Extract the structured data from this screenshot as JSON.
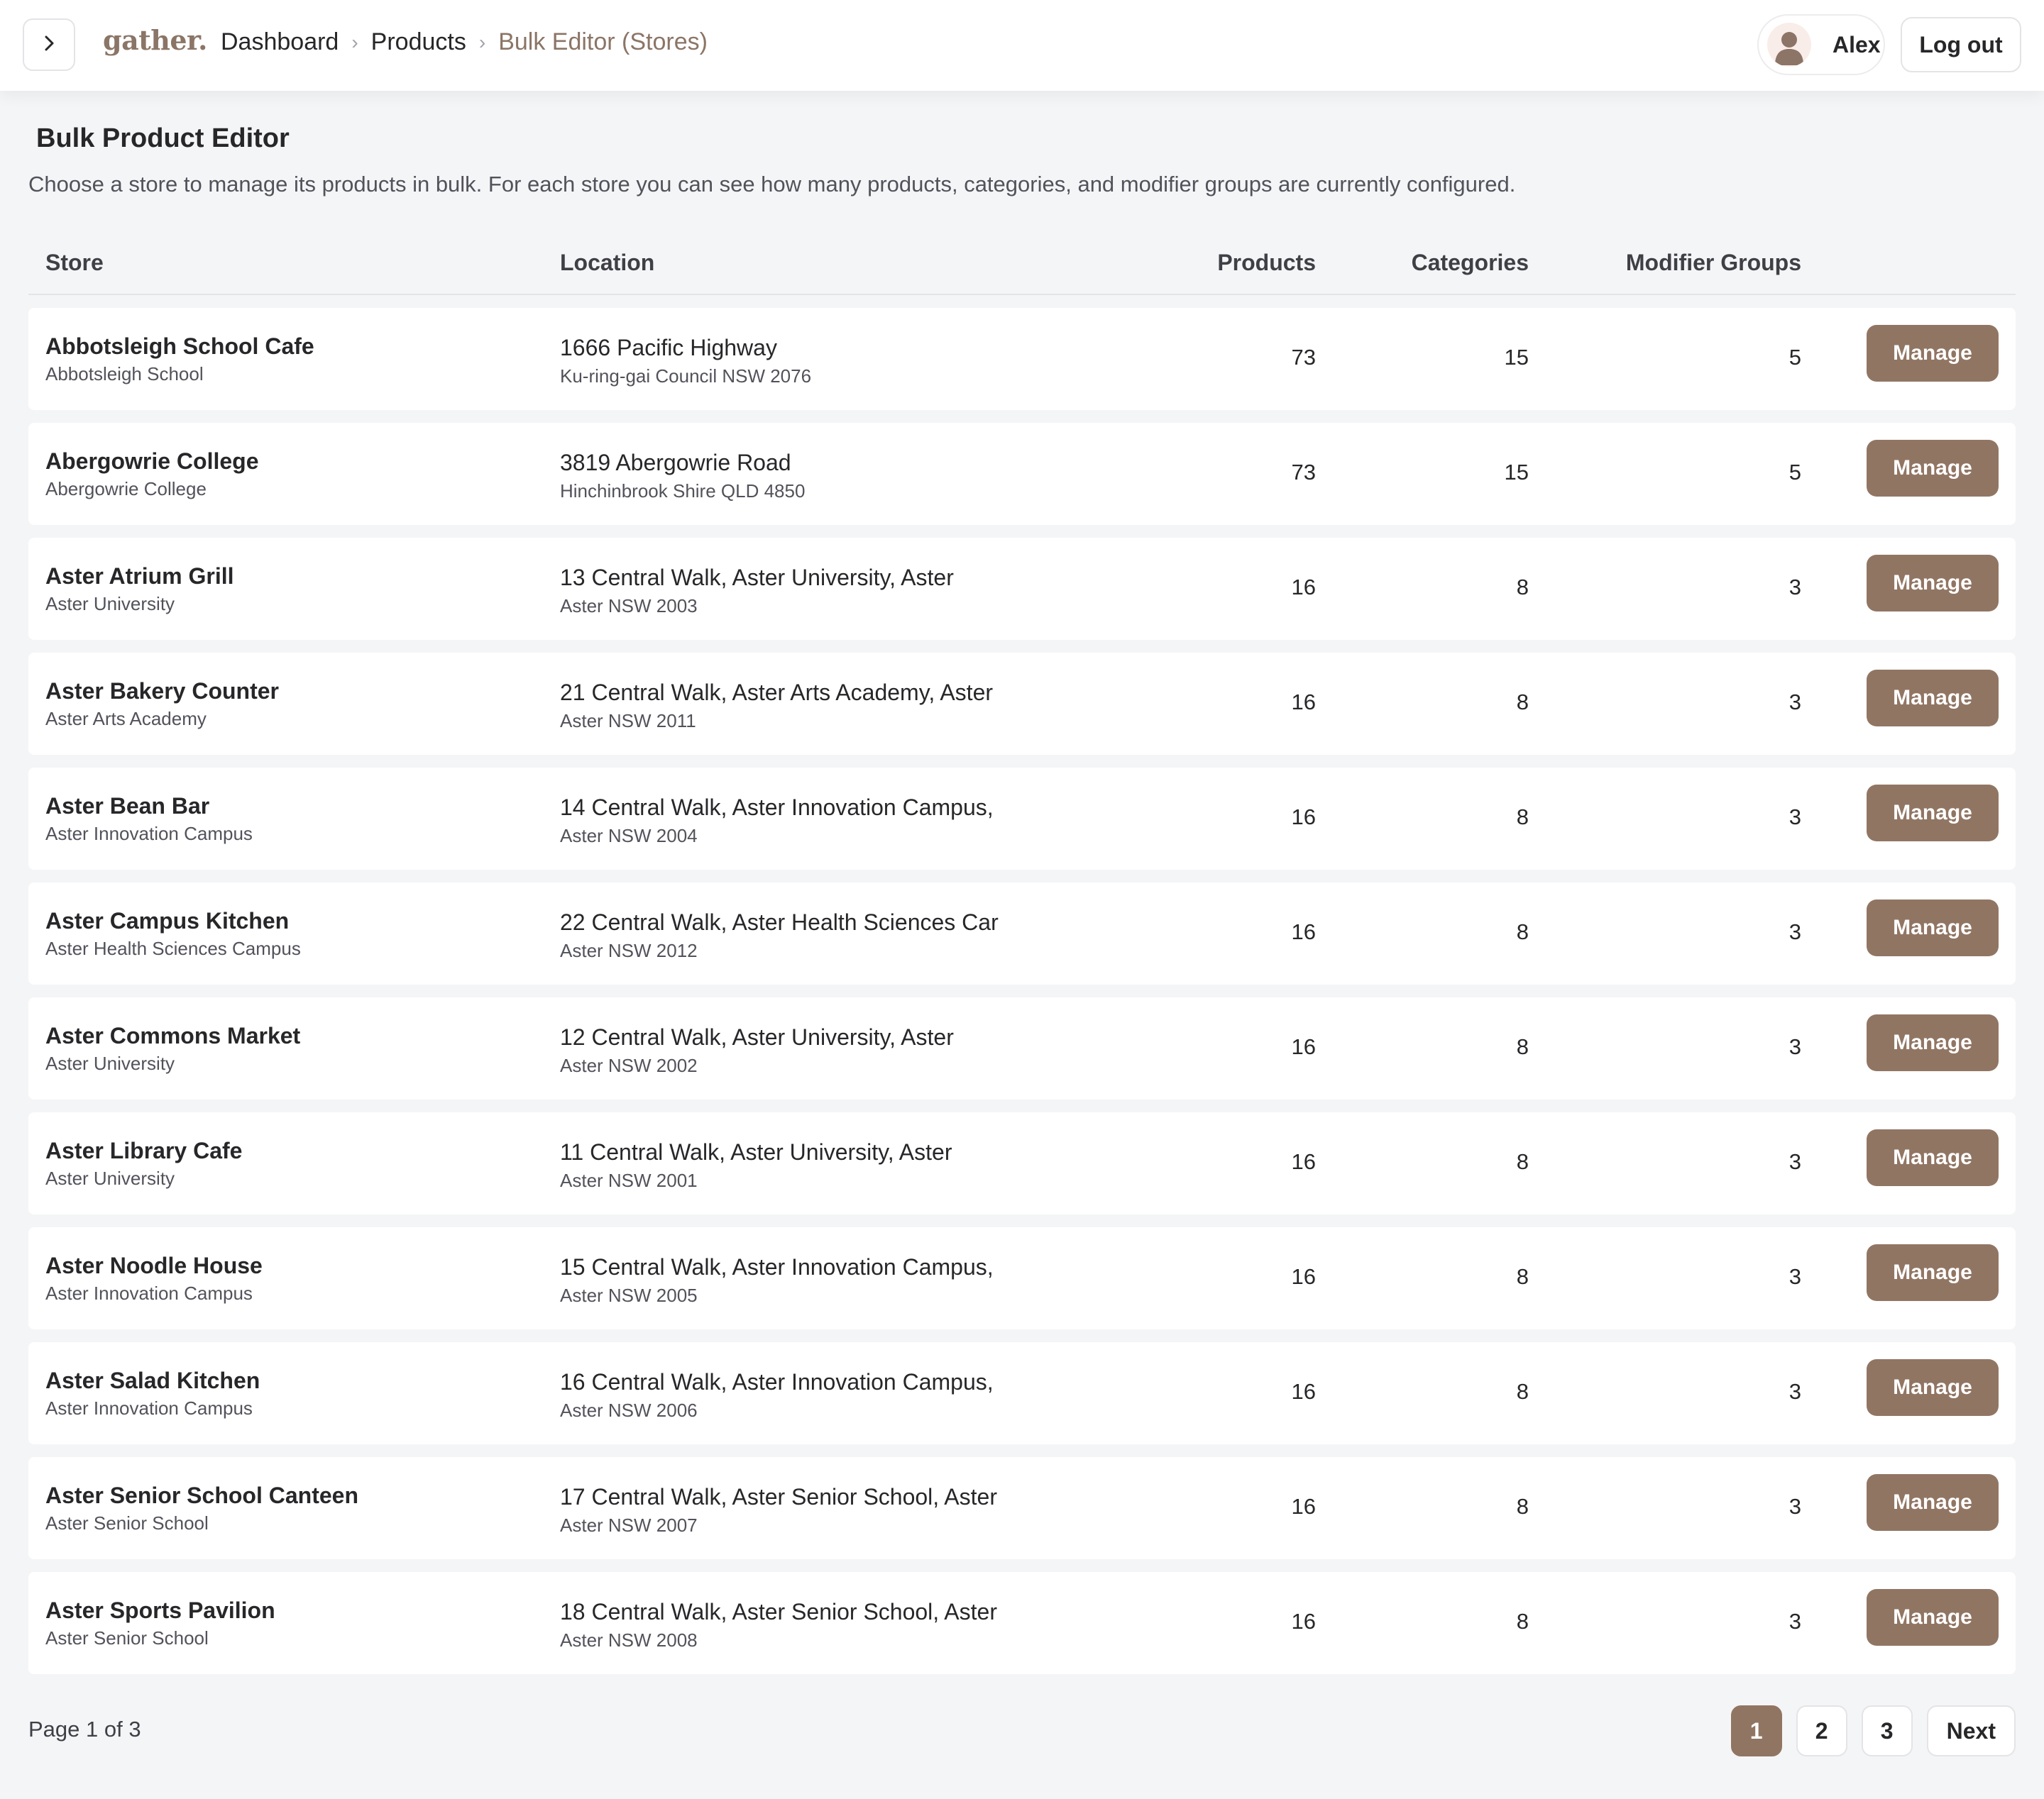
{
  "header": {
    "logo": "gather.",
    "breadcrumb": [
      "Dashboard",
      "Products",
      "Bulk Editor (Stores)"
    ],
    "user_name": "Alex",
    "logout_label": "Log out"
  },
  "page": {
    "title": "Bulk Product Editor",
    "description": "Choose a store to manage its products in bulk. For each store you can see how many products, categories, and modifier groups are currently configured."
  },
  "table": {
    "columns": [
      "Store",
      "Location",
      "Products",
      "Categories",
      "Modifier Groups"
    ],
    "action_label": "Manage",
    "rows": [
      {
        "store": "Abbotsleigh School Cafe",
        "org": "Abbotsleigh School",
        "address": "1666 Pacific Highway",
        "area": "Ku-ring-gai Council NSW 2076",
        "products": "73",
        "categories": "15",
        "modifier_groups": "5"
      },
      {
        "store": "Abergowrie College",
        "org": "Abergowrie College",
        "address": "3819 Abergowrie Road",
        "area": "Hinchinbrook Shire QLD 4850",
        "products": "73",
        "categories": "15",
        "modifier_groups": "5"
      },
      {
        "store": "Aster Atrium Grill",
        "org": "Aster University",
        "address": "13 Central Walk, Aster University, Aster",
        "area": "Aster NSW 2003",
        "products": "16",
        "categories": "8",
        "modifier_groups": "3"
      },
      {
        "store": "Aster Bakery Counter",
        "org": "Aster Arts Academy",
        "address": "21 Central Walk, Aster Arts Academy, Aster",
        "area": "Aster NSW 2011",
        "products": "16",
        "categories": "8",
        "modifier_groups": "3"
      },
      {
        "store": "Aster Bean Bar",
        "org": "Aster Innovation Campus",
        "address": "14 Central Walk, Aster Innovation Campus,",
        "area": "Aster NSW 2004",
        "products": "16",
        "categories": "8",
        "modifier_groups": "3"
      },
      {
        "store": "Aster Campus Kitchen",
        "org": "Aster Health Sciences Campus",
        "address": "22 Central Walk, Aster Health Sciences Car",
        "area": "Aster NSW 2012",
        "products": "16",
        "categories": "8",
        "modifier_groups": "3"
      },
      {
        "store": "Aster Commons Market",
        "org": "Aster University",
        "address": "12 Central Walk, Aster University, Aster",
        "area": "Aster NSW 2002",
        "products": "16",
        "categories": "8",
        "modifier_groups": "3"
      },
      {
        "store": "Aster Library Cafe",
        "org": "Aster University",
        "address": "11 Central Walk, Aster University, Aster",
        "area": "Aster NSW 2001",
        "products": "16",
        "categories": "8",
        "modifier_groups": "3"
      },
      {
        "store": "Aster Noodle House",
        "org": "Aster Innovation Campus",
        "address": "15 Central Walk, Aster Innovation Campus,",
        "area": "Aster NSW 2005",
        "products": "16",
        "categories": "8",
        "modifier_groups": "3"
      },
      {
        "store": "Aster Salad Kitchen",
        "org": "Aster Innovation Campus",
        "address": "16 Central Walk, Aster Innovation Campus,",
        "area": "Aster NSW 2006",
        "products": "16",
        "categories": "8",
        "modifier_groups": "3"
      },
      {
        "store": "Aster Senior School Canteen",
        "org": "Aster Senior School",
        "address": "17 Central Walk, Aster Senior School, Aster",
        "area": "Aster NSW 2007",
        "products": "16",
        "categories": "8",
        "modifier_groups": "3"
      },
      {
        "store": "Aster Sports Pavilion",
        "org": "Aster Senior School",
        "address": "18 Central Walk, Aster Senior School, Aster",
        "area": "Aster NSW 2008",
        "products": "16",
        "categories": "8",
        "modifier_groups": "3"
      }
    ]
  },
  "pagination": {
    "info": "Page 1 of 3",
    "pages": [
      "1",
      "2",
      "3"
    ],
    "current": "1",
    "next_label": "Next"
  },
  "colors": {
    "accent": "#917563",
    "logo": "#8b7566"
  },
  "icons": {
    "sidebar_toggle": "chevron-right-icon",
    "breadcrumb_separator": "chevron-right-icon",
    "avatar": "user-avatar-icon"
  }
}
